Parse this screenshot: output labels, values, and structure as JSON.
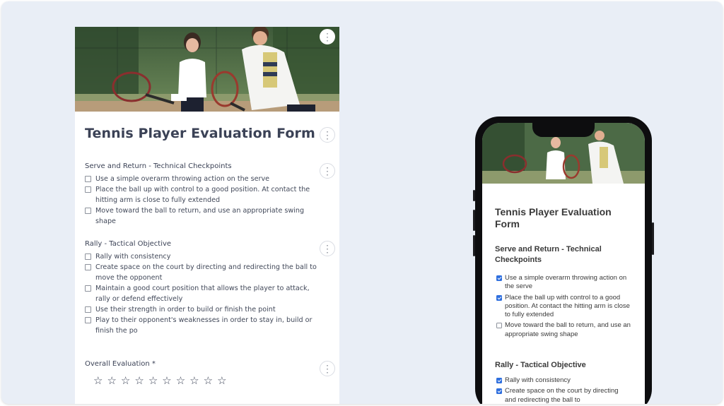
{
  "form": {
    "title": "Tennis Player Evaluation Form",
    "sections": [
      {
        "title": "Serve and Return - Technical Checkpoints",
        "items": [
          "Use a simple overarm throwing action on the serve",
          "Place the ball up with control to a good position. At contact the hitting arm is close to fully extended",
          "Move toward the ball to return, and use an appropriate swing shape"
        ]
      },
      {
        "title": "Rally - Tactical Objective",
        "items": [
          "Rally with consistency",
          "Create space on the court by directing and redirecting the ball to move the opponent",
          "Maintain a good court position that allows the player to attack, rally or defend effectively",
          "Use their strength in order to build or finish the point",
          "Play to their opponent's weaknesses in order to stay in, build or finish the po"
        ]
      }
    ],
    "rating": {
      "label": "Overall Evaluation *",
      "max": 10,
      "value": 0
    },
    "menu_glyph": "⋮"
  },
  "phone": {
    "title": "Tennis Player Evaluation Form",
    "sections": [
      {
        "title": "Serve and Return - Technical Checkpoints",
        "items": [
          {
            "label": "Use a simple overarm throwing action on the serve",
            "checked": true
          },
          {
            "label": "Place the ball up with control to a good position. At contact the hitting arm is close to fully extended",
            "checked": true
          },
          {
            "label": "Move toward the ball to return, and use an appropriate swing shape",
            "checked": false
          }
        ]
      },
      {
        "title": "Rally - Tactical Objective",
        "items": [
          {
            "label": "Rally with consistency",
            "checked": true
          },
          {
            "label": "Create space on the court by directing and redirecting the ball to",
            "checked": true
          }
        ]
      }
    ]
  },
  "colors": {
    "background": "#e9eef6",
    "card": "#ffffff",
    "title_text": "#3b4256",
    "checkbox_checked": "#2f6fde",
    "phone_frame": "#0d0d0f"
  }
}
